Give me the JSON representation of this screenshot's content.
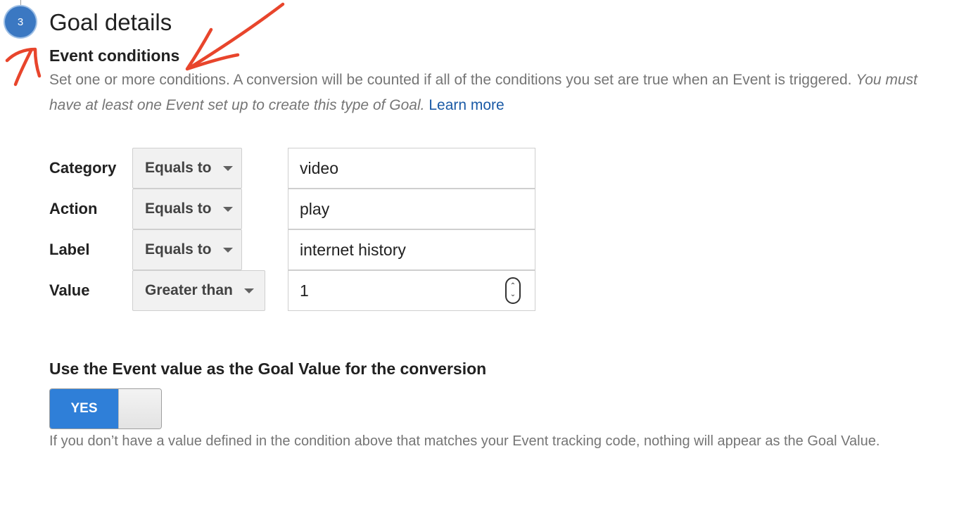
{
  "step": {
    "number": "3",
    "title": "Goal details"
  },
  "event_conditions": {
    "heading": "Event conditions",
    "description": "Set one or more conditions. A conversion will be counted if all of the conditions you set are true when an Event is triggered.",
    "description_italic": "You must have at least one Event set up to create this type of Goal.",
    "learn_more": "Learn more"
  },
  "conditions": [
    {
      "label": "Category",
      "operator": "Equals to",
      "value": "video"
    },
    {
      "label": "Action",
      "operator": "Equals to",
      "value": "play"
    },
    {
      "label": "Label",
      "operator": "Equals to",
      "value": "internet history"
    },
    {
      "label": "Value",
      "operator": "Greater than",
      "value": "1"
    }
  ],
  "goal_value": {
    "heading": "Use the Event value as the Goal Value for the conversion",
    "toggle_label": "YES",
    "toggle_state": "on",
    "note": "If you don’t have a value defined in the condition above that matches your Event tracking code, nothing will appear as the Goal Value."
  },
  "colors": {
    "accent_blue": "#2f7fd8",
    "link_blue": "#1a5aa6",
    "annotation_red": "#e8452c"
  },
  "icons": {
    "dropdown": "caret-down-icon",
    "number_spinner": "spinner-icon"
  }
}
